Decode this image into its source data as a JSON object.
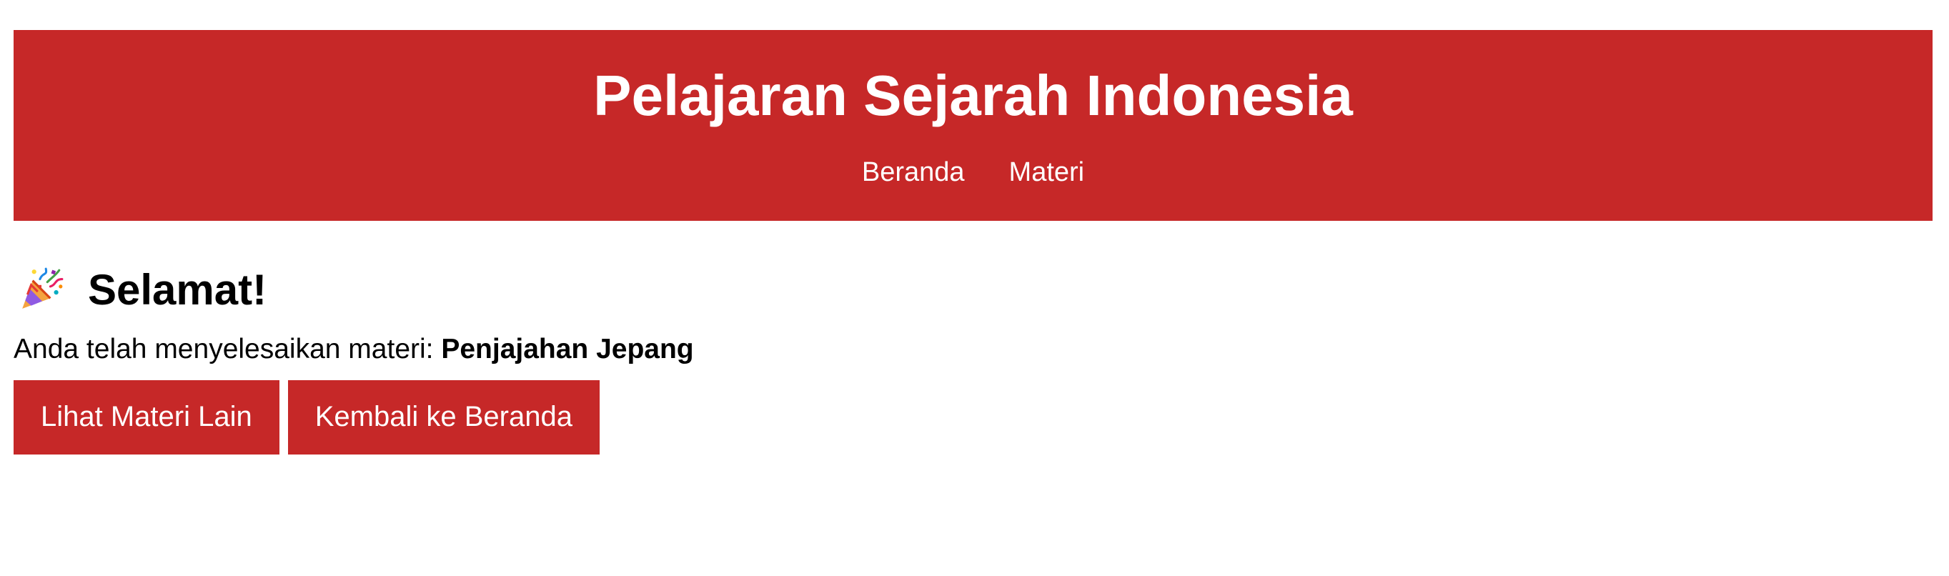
{
  "header": {
    "title": "Pelajaran Sejarah Indonesia",
    "nav": [
      {
        "label": "Beranda"
      },
      {
        "label": "Materi"
      }
    ]
  },
  "main": {
    "icon": "party-popper-icon",
    "heading": "Selamat!",
    "message_prefix": "Anda telah menyelesaikan materi: ",
    "topic": "Penjajahan Jepang",
    "buttons": [
      {
        "label": "Lihat Materi Lain"
      },
      {
        "label": "Kembali ke Beranda"
      }
    ]
  },
  "colors": {
    "accent": "#c62828",
    "text_on_accent": "#ffffff"
  }
}
